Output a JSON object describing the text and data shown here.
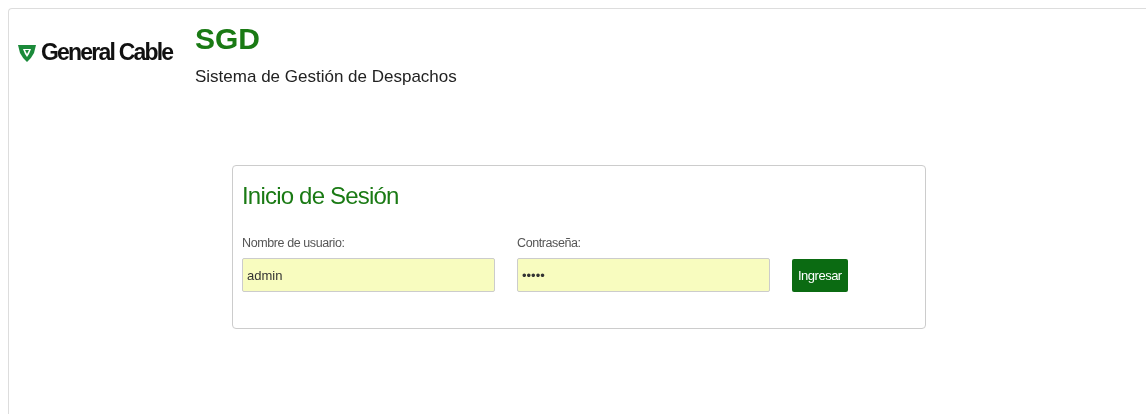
{
  "header": {
    "logo_text": "General Cable",
    "title": "SGD",
    "subtitle": "Sistema de Gestión de Despachos"
  },
  "login": {
    "title": "Inicio de Sesión",
    "fields": [
      {
        "label": "Nombre de usuario:",
        "value": "admin"
      },
      {
        "label": "Contraseña:",
        "value": "•••••"
      }
    ],
    "button": "Ingresar"
  }
}
